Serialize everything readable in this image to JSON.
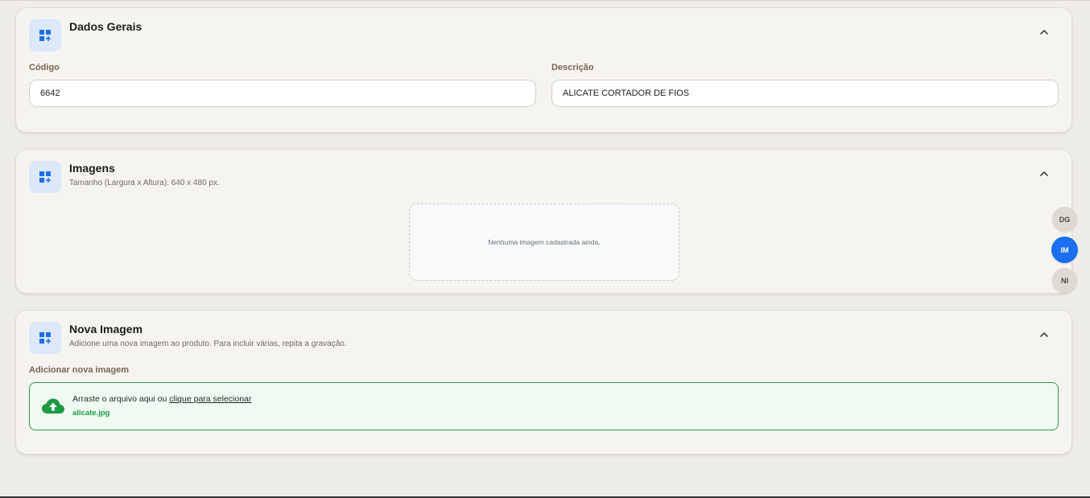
{
  "sections": {
    "dados_gerais": {
      "title": "Dados Gerais",
      "codigo_label": "Código",
      "codigo_value": "6642",
      "descricao_label": "Descrição",
      "descricao_value": "ALICATE CORTADOR DE FIOS"
    },
    "imagens": {
      "title": "Imagens",
      "subtitle": "Tamanho (Largura x Altura): 640 x 480 px.",
      "empty_text": "Nenhuma imagem cadastrada ainda."
    },
    "nova_imagem": {
      "title": "Nova Imagem",
      "subtitle": "Adicione uma nova imagem ao produto. Para incluir várias, repita a gravação.",
      "field_label": "Adicionar nova imagem",
      "drop_text": "Arraste o arquivo aqui ou ",
      "drop_link": "clique para selecionar",
      "file_name": "alicate.jpg"
    }
  },
  "side_nav": {
    "items": [
      {
        "label": "DG",
        "active": false
      },
      {
        "label": "IM",
        "active": true
      },
      {
        "label": "NI",
        "active": false
      }
    ]
  },
  "icons": {
    "section_icon": "grid-add-icon",
    "collapse_icon": "chevron-up-icon",
    "upload_icon": "cloud-upload-icon"
  },
  "colors": {
    "accent_blue": "#1b6ff0",
    "icon_tile_bg": "#dde8fb",
    "upload_green": "#1e9a43",
    "label_brown": "#7a6552"
  }
}
